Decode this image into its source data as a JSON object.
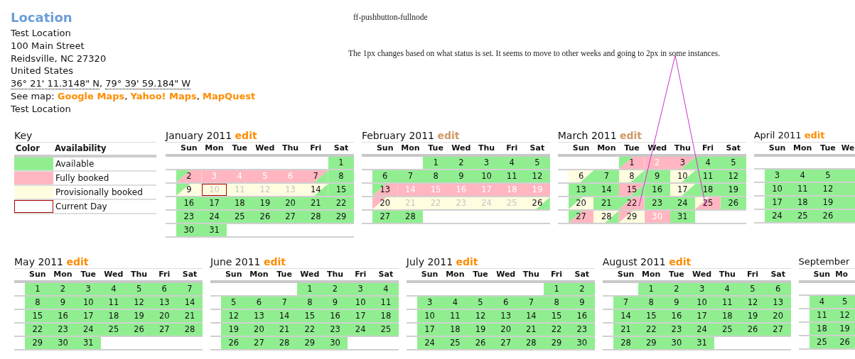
{
  "location": {
    "title": "Location",
    "lines": [
      "Test Location",
      "100 Main Street",
      "Reidsville, NC 27320",
      "United States"
    ],
    "coordinates": [
      {
        "text": "36° 21' 11.3148\" N",
        "after": ","
      },
      {
        "text": "79° 39' 59.184\" W"
      }
    ],
    "map": {
      "label": "See map:",
      "links": [
        {
          "text": "Google Maps",
          "after": ","
        },
        {
          "text": "Yahoo! Maps",
          "after": ","
        },
        {
          "text": "MapQuest"
        }
      ]
    },
    "footer": "Test Location"
  },
  "notes": [
    "ff-pushbutton-fullnode",
    "The 1px changes based on what status is set. It seems to move to other weeks and going to 2px in some instances."
  ],
  "key": {
    "title": "Key",
    "columns": [
      "Color",
      "Availability"
    ],
    "rows": [
      {
        "color": "#90ee90",
        "current": false,
        "label": "Available"
      },
      {
        "color": "#ffb6c1",
        "current": false,
        "label": "Fully booked"
      },
      {
        "color": "#fffde0",
        "current": false,
        "label": "Provisionally booked"
      },
      {
        "current": true,
        "label": "Current Day"
      }
    ]
  },
  "months": [
    {
      "title": "January 2011",
      "edit": "edit",
      "visited": false,
      "weekdays": [
        "Sun",
        "Mon",
        "Tue",
        "Wed",
        "Thu",
        "Fri",
        "Sat"
      ],
      "weeks": [
        [
          {
            "kind": "blank"
          },
          {
            "kind": "blank"
          },
          {
            "kind": "blank"
          },
          {
            "kind": "blank"
          },
          {
            "kind": "blank"
          },
          {
            "kind": "blank"
          },
          {
            "kind": "day",
            "day": "1",
            "color": "#90ee90"
          }
        ],
        [
          {
            "kind": "split",
            "day": "2",
            "halves": [
              {
                "color": "#90ee90"
              },
              {
                "color": "#ffb6c1"
              }
            ]
          },
          {
            "kind": "day",
            "day": "3",
            "color": "#ffb6c1"
          },
          {
            "kind": "day",
            "day": "4",
            "color": "#ffb6c1"
          },
          {
            "kind": "day",
            "day": "5",
            "color": "#ffb6c1"
          },
          {
            "kind": "day",
            "day": "6",
            "color": "#ffb6c1"
          },
          {
            "kind": "split",
            "day": "7",
            "halves": [
              {
                "color": "#ffb6c1"
              },
              {
                "color": "#90ee90"
              }
            ]
          },
          {
            "kind": "day",
            "day": "8",
            "color": "#90ee90"
          }
        ],
        [
          {
            "kind": "split",
            "day": "9",
            "halves": [
              {
                "color": "#90ee90"
              },
              {
                "color": "#fffde0"
              }
            ]
          },
          {
            "kind": "day",
            "day": "10",
            "color": "#fffde0",
            "current": true
          },
          {
            "kind": "day",
            "day": "11",
            "color": "#fffde0"
          },
          {
            "kind": "day",
            "day": "12",
            "color": "#fffde0"
          },
          {
            "kind": "day",
            "day": "13",
            "color": "#fffde0"
          },
          {
            "kind": "split",
            "day": "14",
            "halves": [
              {
                "color": "#fffde0"
              },
              {
                "color": "#90ee90"
              }
            ]
          },
          {
            "kind": "day",
            "day": "15",
            "color": "#90ee90"
          }
        ],
        [
          {
            "kind": "day",
            "day": "16",
            "color": "#90ee90"
          },
          {
            "kind": "day",
            "day": "17",
            "color": "#90ee90"
          },
          {
            "kind": "day",
            "day": "18",
            "color": "#90ee90"
          },
          {
            "kind": "day",
            "day": "19",
            "color": "#90ee90"
          },
          {
            "kind": "day",
            "day": "20",
            "color": "#90ee90"
          },
          {
            "kind": "day",
            "day": "21",
            "color": "#90ee90"
          },
          {
            "kind": "day",
            "day": "22",
            "color": "#90ee90"
          }
        ],
        [
          {
            "kind": "day",
            "day": "23",
            "color": "#90ee90"
          },
          {
            "kind": "day",
            "day": "24",
            "color": "#90ee90"
          },
          {
            "kind": "day",
            "day": "25",
            "color": "#90ee90"
          },
          {
            "kind": "day",
            "day": "26",
            "color": "#90ee90"
          },
          {
            "kind": "day",
            "day": "27",
            "color": "#90ee90"
          },
          {
            "kind": "day",
            "day": "28",
            "color": "#90ee90"
          },
          {
            "kind": "day",
            "day": "29",
            "color": "#90ee90"
          }
        ],
        [
          {
            "kind": "day",
            "day": "30",
            "color": "#90ee90"
          },
          {
            "kind": "day",
            "day": "31",
            "color": "#90ee90"
          },
          {
            "kind": "blank"
          },
          {
            "kind": "blank"
          },
          {
            "kind": "blank"
          },
          {
            "kind": "blank"
          },
          {
            "kind": "blank"
          }
        ]
      ]
    },
    {
      "title": "February 2011",
      "edit": "edit",
      "visited": true,
      "weekdays": [
        "Sun",
        "Mon",
        "Tue",
        "Wed",
        "Thu",
        "Fri",
        "Sat"
      ],
      "weeks": [
        [
          {
            "kind": "blank"
          },
          {
            "kind": "blank"
          },
          {
            "kind": "day",
            "day": "1",
            "color": "#90ee90"
          },
          {
            "kind": "day",
            "day": "2",
            "color": "#90ee90"
          },
          {
            "kind": "day",
            "day": "3",
            "color": "#90ee90"
          },
          {
            "kind": "day",
            "day": "4",
            "color": "#90ee90"
          },
          {
            "kind": "day",
            "day": "5",
            "color": "#90ee90"
          }
        ],
        [
          {
            "kind": "day",
            "day": "6",
            "color": "#90ee90"
          },
          {
            "kind": "day",
            "day": "7",
            "color": "#90ee90"
          },
          {
            "kind": "day",
            "day": "8",
            "color": "#90ee90"
          },
          {
            "kind": "day",
            "day": "9",
            "color": "#90ee90"
          },
          {
            "kind": "day",
            "day": "10",
            "color": "#90ee90"
          },
          {
            "kind": "day",
            "day": "11",
            "color": "#90ee90"
          },
          {
            "kind": "day",
            "day": "12",
            "color": "#90ee90"
          }
        ],
        [
          {
            "kind": "split",
            "day": "13",
            "halves": [
              {
                "color": "#90ee90"
              },
              {
                "color": "#ffb6c1"
              }
            ]
          },
          {
            "kind": "day",
            "day": "14",
            "color": "#ffb6c1"
          },
          {
            "kind": "day",
            "day": "15",
            "color": "#ffb6c1"
          },
          {
            "kind": "day",
            "day": "16",
            "color": "#ffb6c1"
          },
          {
            "kind": "day",
            "day": "17",
            "color": "#ffb6c1"
          },
          {
            "kind": "day",
            "day": "18",
            "color": "#ffb6c1"
          },
          {
            "kind": "day",
            "day": "19",
            "color": "#ffb6c1"
          }
        ],
        [
          {
            "kind": "split",
            "day": "20",
            "halves": [
              {
                "color": "#ffb6c1"
              },
              {
                "color": "#fffde0"
              }
            ]
          },
          {
            "kind": "day",
            "day": "21",
            "color": "#fffde0"
          },
          {
            "kind": "day",
            "day": "22",
            "color": "#fffde0"
          },
          {
            "kind": "day",
            "day": "23",
            "color": "#fffde0"
          },
          {
            "kind": "day",
            "day": "24",
            "color": "#fffde0"
          },
          {
            "kind": "day",
            "day": "25",
            "color": "#fffde0"
          },
          {
            "kind": "split",
            "day": "26",
            "halves": [
              {
                "color": "#fffde0"
              },
              {
                "color": "#90ee90"
              }
            ]
          }
        ],
        [
          {
            "kind": "day",
            "day": "27",
            "color": "#90ee90"
          },
          {
            "kind": "day",
            "day": "28",
            "color": "#90ee90"
          },
          {
            "kind": "blank"
          },
          {
            "kind": "blank"
          },
          {
            "kind": "blank"
          },
          {
            "kind": "blank"
          },
          {
            "kind": "blank"
          }
        ]
      ]
    },
    {
      "title": "March 2011",
      "edit": "edit",
      "visited": true,
      "weekdays": [
        "Sun",
        "Mon",
        "Tue",
        "Wed",
        "Thu",
        "Fri",
        "Sat"
      ],
      "weeks": [
        [
          {
            "kind": "blank"
          },
          {
            "kind": "blank"
          },
          {
            "kind": "split",
            "day": "1",
            "halves": [
              {
                "color": "#90ee90"
              },
              {
                "color": "#ffb6c1"
              }
            ]
          },
          {
            "kind": "day",
            "day": "2",
            "color": "#ffb6c1"
          },
          {
            "kind": "split",
            "day": "3",
            "halves": [
              {
                "color": "#ffb6c1"
              },
              {
                "color": "#90ee90"
              }
            ]
          },
          {
            "kind": "day",
            "day": "4",
            "color": "#90ee90"
          },
          {
            "kind": "day",
            "day": "5",
            "color": "#90ee90"
          }
        ],
        [
          {
            "kind": "split",
            "day": "6",
            "halves": [
              {
                "color": "#fffde0"
              },
              {
                "color": "#90ee90"
              }
            ]
          },
          {
            "kind": "day",
            "day": "7",
            "color": "#90ee90"
          },
          {
            "kind": "split",
            "day": "8",
            "halves": [
              {
                "color": "#fffde0"
              },
              {
                "color": "#90ee90"
              }
            ]
          },
          {
            "kind": "day",
            "day": "9",
            "color": "#90ee90"
          },
          {
            "kind": "split",
            "day": "10",
            "halves": [
              {
                "color": "#fffde0"
              },
              {
                "color": "#90ee90"
              }
            ]
          },
          {
            "kind": "day",
            "day": "11",
            "color": "#90ee90"
          },
          {
            "kind": "day",
            "day": "12",
            "color": "#90ee90"
          }
        ],
        [
          {
            "kind": "day",
            "day": "13",
            "color": "#90ee90"
          },
          {
            "kind": "day",
            "day": "14",
            "color": "#90ee90"
          },
          {
            "kind": "split",
            "day": "15",
            "halves": [
              {
                "color": "#ffb6c1"
              },
              {
                "color": "#90ee90"
              }
            ]
          },
          {
            "kind": "day",
            "day": "16",
            "color": "#90ee90"
          },
          {
            "kind": "split",
            "day": "17",
            "halves": [
              {
                "color": "#fffde0"
              },
              {
                "color": "#90ee90"
              }
            ]
          },
          {
            "kind": "day",
            "day": "18",
            "color": "#90ee90"
          },
          {
            "kind": "day",
            "day": "19",
            "color": "#90ee90"
          }
        ],
        [
          {
            "kind": "split",
            "day": "20",
            "halves": [
              {
                "color": "#90ee90"
              },
              {
                "color": "#fffde0"
              }
            ]
          },
          {
            "kind": "day",
            "day": "21",
            "color": "#90ee90"
          },
          {
            "kind": "split",
            "day": "22",
            "halves": [
              {
                "color": "#90ee90"
              },
              {
                "color": "#ffb6c1"
              }
            ]
          },
          {
            "kind": "day",
            "day": "23",
            "color": "#90ee90"
          },
          {
            "kind": "day",
            "day": "24",
            "color": "#90ee90"
          },
          {
            "kind": "split",
            "day": "25",
            "halves": [
              {
                "color": "#fffde0"
              },
              {
                "color": "#ffb6c1"
              }
            ]
          },
          {
            "kind": "day",
            "day": "26",
            "color": "#90ee90"
          }
        ],
        [
          {
            "kind": "split",
            "day": "27",
            "halves": [
              {
                "color": "#90ee90"
              },
              {
                "color": "#ffb6c1"
              }
            ]
          },
          {
            "kind": "split",
            "day": "28",
            "halves": [
              {
                "color": "#fffde0"
              },
              {
                "color": "#90ee90"
              }
            ]
          },
          {
            "kind": "split",
            "day": "29",
            "halves": [
              {
                "color": "#ffb6c1"
              },
              {
                "color": "#fffde0"
              }
            ]
          },
          {
            "kind": "day",
            "day": "30",
            "color": "#ffb6c1"
          },
          {
            "kind": "day",
            "day": "31",
            "color": "#90ee90"
          },
          {
            "kind": "blank"
          },
          {
            "kind": "blank"
          }
        ]
      ]
    },
    {
      "title": "April 2011",
      "edit": "edit",
      "visited": false,
      "weekdays": [
        "Sun",
        "Mon",
        "Tue",
        "We"
      ],
      "weeks": [
        [
          {
            "kind": "blank"
          },
          {
            "kind": "blank"
          },
          {
            "kind": "blank"
          },
          {
            "kind": "blank"
          }
        ],
        [
          {
            "kind": "day",
            "day": "3",
            "color": "#90ee90"
          },
          {
            "kind": "day",
            "day": "4",
            "color": "#90ee90"
          },
          {
            "kind": "day",
            "day": "5",
            "color": "#90ee90"
          },
          {
            "kind": "day",
            "color": "#90ee90"
          }
        ],
        [
          {
            "kind": "day",
            "day": "10",
            "color": "#90ee90"
          },
          {
            "kind": "day",
            "day": "11",
            "color": "#90ee90"
          },
          {
            "kind": "day",
            "day": "12",
            "color": "#90ee90"
          },
          {
            "kind": "day",
            "color": "#90ee90"
          }
        ],
        [
          {
            "kind": "day",
            "day": "17",
            "color": "#90ee90"
          },
          {
            "kind": "day",
            "day": "18",
            "color": "#90ee90"
          },
          {
            "kind": "day",
            "day": "19",
            "color": "#90ee90"
          },
          {
            "kind": "day",
            "color": "#90ee90"
          }
        ],
        [
          {
            "kind": "day",
            "day": "24",
            "color": "#90ee90"
          },
          {
            "kind": "day",
            "day": "25",
            "color": "#90ee90"
          },
          {
            "kind": "day",
            "day": "26",
            "color": "#90ee90"
          },
          {
            "kind": "day",
            "color": "#90ee90"
          }
        ]
      ]
    },
    {
      "title": "May 2011",
      "edit": "edit",
      "visited": false,
      "weekdays": [
        "Sun",
        "Mon",
        "Tue",
        "Wed",
        "Thu",
        "Fri",
        "Sat"
      ],
      "weeks": [
        [
          {
            "kind": "day",
            "day": "1",
            "color": "#90ee90"
          },
          {
            "kind": "day",
            "day": "2",
            "color": "#90ee90"
          },
          {
            "kind": "day",
            "day": "3",
            "color": "#90ee90"
          },
          {
            "kind": "day",
            "day": "4",
            "color": "#90ee90"
          },
          {
            "kind": "day",
            "day": "5",
            "color": "#90ee90"
          },
          {
            "kind": "day",
            "day": "6",
            "color": "#90ee90"
          },
          {
            "kind": "day",
            "day": "7",
            "color": "#90ee90"
          }
        ],
        [
          {
            "kind": "day",
            "day": "8",
            "color": "#90ee90"
          },
          {
            "kind": "day",
            "day": "9",
            "color": "#90ee90"
          },
          {
            "kind": "day",
            "day": "10",
            "color": "#90ee90"
          },
          {
            "kind": "day",
            "day": "11",
            "color": "#90ee90"
          },
          {
            "kind": "day",
            "day": "12",
            "color": "#90ee90"
          },
          {
            "kind": "day",
            "day": "13",
            "color": "#90ee90"
          },
          {
            "kind": "day",
            "day": "14",
            "color": "#90ee90"
          }
        ],
        [
          {
            "kind": "day",
            "day": "15",
            "color": "#90ee90"
          },
          {
            "kind": "day",
            "day": "16",
            "color": "#90ee90"
          },
          {
            "kind": "day",
            "day": "17",
            "color": "#90ee90"
          },
          {
            "kind": "day",
            "day": "18",
            "color": "#90ee90"
          },
          {
            "kind": "day",
            "day": "19",
            "color": "#90ee90"
          },
          {
            "kind": "day",
            "day": "20",
            "color": "#90ee90"
          },
          {
            "kind": "day",
            "day": "21",
            "color": "#90ee90"
          }
        ],
        [
          {
            "kind": "day",
            "day": "22",
            "color": "#90ee90"
          },
          {
            "kind": "day",
            "day": "23",
            "color": "#90ee90"
          },
          {
            "kind": "day",
            "day": "24",
            "color": "#90ee90"
          },
          {
            "kind": "day",
            "day": "25",
            "color": "#90ee90"
          },
          {
            "kind": "day",
            "day": "26",
            "color": "#90ee90"
          },
          {
            "kind": "day",
            "day": "27",
            "color": "#90ee90"
          },
          {
            "kind": "day",
            "day": "28",
            "color": "#90ee90"
          }
        ],
        [
          {
            "kind": "day",
            "day": "29",
            "color": "#90ee90"
          },
          {
            "kind": "day",
            "day": "30",
            "color": "#90ee90"
          },
          {
            "kind": "day",
            "day": "31",
            "color": "#90ee90"
          },
          {
            "kind": "blank"
          },
          {
            "kind": "blank"
          },
          {
            "kind": "blank"
          },
          {
            "kind": "blank"
          }
        ]
      ]
    },
    {
      "title": "June 2011",
      "edit": "edit",
      "visited": false,
      "weekdays": [
        "Sun",
        "Mon",
        "Tue",
        "Wed",
        "Thu",
        "Fri",
        "Sat"
      ],
      "weeks": [
        [
          {
            "kind": "blank"
          },
          {
            "kind": "blank"
          },
          {
            "kind": "blank"
          },
          {
            "kind": "day",
            "day": "1",
            "color": "#90ee90"
          },
          {
            "kind": "day",
            "day": "2",
            "color": "#90ee90"
          },
          {
            "kind": "day",
            "day": "3",
            "color": "#90ee90"
          },
          {
            "kind": "day",
            "day": "4",
            "color": "#90ee90"
          }
        ],
        [
          {
            "kind": "day",
            "day": "5",
            "color": "#90ee90"
          },
          {
            "kind": "day",
            "day": "6",
            "color": "#90ee90"
          },
          {
            "kind": "day",
            "day": "7",
            "color": "#90ee90"
          },
          {
            "kind": "day",
            "day": "8",
            "color": "#90ee90"
          },
          {
            "kind": "day",
            "day": "9",
            "color": "#90ee90"
          },
          {
            "kind": "day",
            "day": "10",
            "color": "#90ee90"
          },
          {
            "kind": "day",
            "day": "11",
            "color": "#90ee90"
          }
        ],
        [
          {
            "kind": "day",
            "day": "12",
            "color": "#90ee90"
          },
          {
            "kind": "day",
            "day": "13",
            "color": "#90ee90"
          },
          {
            "kind": "day",
            "day": "14",
            "color": "#90ee90"
          },
          {
            "kind": "day",
            "day": "15",
            "color": "#90ee90"
          },
          {
            "kind": "day",
            "day": "16",
            "color": "#90ee90"
          },
          {
            "kind": "day",
            "day": "17",
            "color": "#90ee90"
          },
          {
            "kind": "day",
            "day": "18",
            "color": "#90ee90"
          }
        ],
        [
          {
            "kind": "day",
            "day": "19",
            "color": "#90ee90"
          },
          {
            "kind": "day",
            "day": "20",
            "color": "#90ee90"
          },
          {
            "kind": "day",
            "day": "21",
            "color": "#90ee90"
          },
          {
            "kind": "day",
            "day": "22",
            "color": "#90ee90"
          },
          {
            "kind": "day",
            "day": "23",
            "color": "#90ee90"
          },
          {
            "kind": "day",
            "day": "24",
            "color": "#90ee90"
          },
          {
            "kind": "day",
            "day": "25",
            "color": "#90ee90"
          }
        ],
        [
          {
            "kind": "day",
            "day": "26",
            "color": "#90ee90"
          },
          {
            "kind": "day",
            "day": "27",
            "color": "#90ee90"
          },
          {
            "kind": "day",
            "day": "28",
            "color": "#90ee90"
          },
          {
            "kind": "day",
            "day": "29",
            "color": "#90ee90"
          },
          {
            "kind": "day",
            "day": "30",
            "color": "#90ee90"
          },
          {
            "kind": "blank"
          },
          {
            "kind": "blank"
          }
        ]
      ]
    },
    {
      "title": "July 2011",
      "edit": "edit",
      "visited": false,
      "weekdays": [
        "Sun",
        "Mon",
        "Tue",
        "Wed",
        "Thu",
        "Fri",
        "Sat"
      ],
      "weeks": [
        [
          {
            "kind": "blank"
          },
          {
            "kind": "blank"
          },
          {
            "kind": "blank"
          },
          {
            "kind": "blank"
          },
          {
            "kind": "blank"
          },
          {
            "kind": "day",
            "day": "1",
            "color": "#90ee90"
          },
          {
            "kind": "day",
            "day": "2",
            "color": "#90ee90"
          }
        ],
        [
          {
            "kind": "day",
            "day": "3",
            "color": "#90ee90"
          },
          {
            "kind": "day",
            "day": "4",
            "color": "#90ee90"
          },
          {
            "kind": "day",
            "day": "5",
            "color": "#90ee90"
          },
          {
            "kind": "day",
            "day": "6",
            "color": "#90ee90"
          },
          {
            "kind": "day",
            "day": "7",
            "color": "#90ee90"
          },
          {
            "kind": "day",
            "day": "8",
            "color": "#90ee90"
          },
          {
            "kind": "day",
            "day": "9",
            "color": "#90ee90"
          }
        ],
        [
          {
            "kind": "day",
            "day": "10",
            "color": "#90ee90"
          },
          {
            "kind": "day",
            "day": "11",
            "color": "#90ee90"
          },
          {
            "kind": "day",
            "day": "12",
            "color": "#90ee90"
          },
          {
            "kind": "day",
            "day": "13",
            "color": "#90ee90"
          },
          {
            "kind": "day",
            "day": "14",
            "color": "#90ee90"
          },
          {
            "kind": "day",
            "day": "15",
            "color": "#90ee90"
          },
          {
            "kind": "day",
            "day": "16",
            "color": "#90ee90"
          }
        ],
        [
          {
            "kind": "day",
            "day": "17",
            "color": "#90ee90"
          },
          {
            "kind": "day",
            "day": "18",
            "color": "#90ee90"
          },
          {
            "kind": "day",
            "day": "19",
            "color": "#90ee90"
          },
          {
            "kind": "day",
            "day": "20",
            "color": "#90ee90"
          },
          {
            "kind": "day",
            "day": "21",
            "color": "#90ee90"
          },
          {
            "kind": "day",
            "day": "22",
            "color": "#90ee90"
          },
          {
            "kind": "day",
            "day": "23",
            "color": "#90ee90"
          }
        ],
        [
          {
            "kind": "day",
            "day": "24",
            "color": "#90ee90"
          },
          {
            "kind": "day",
            "day": "25",
            "color": "#90ee90"
          },
          {
            "kind": "day",
            "day": "26",
            "color": "#90ee90"
          },
          {
            "kind": "day",
            "day": "27",
            "color": "#90ee90"
          },
          {
            "kind": "day",
            "day": "28",
            "color": "#90ee90"
          },
          {
            "kind": "day",
            "day": "29",
            "color": "#90ee90"
          },
          {
            "kind": "day",
            "day": "30",
            "color": "#90ee90"
          }
        ]
      ]
    },
    {
      "title": "August 2011",
      "edit": "edit",
      "visited": false,
      "weekdays": [
        "Sun",
        "Mon",
        "Tue",
        "Wed",
        "Thu",
        "Fri",
        "Sat"
      ],
      "weeks": [
        [
          {
            "kind": "blank"
          },
          {
            "kind": "day",
            "day": "1",
            "color": "#90ee90"
          },
          {
            "kind": "day",
            "day": "2",
            "color": "#90ee90"
          },
          {
            "kind": "day",
            "day": "3",
            "color": "#90ee90"
          },
          {
            "kind": "day",
            "day": "4",
            "color": "#90ee90"
          },
          {
            "kind": "day",
            "day": "5",
            "color": "#90ee90"
          },
          {
            "kind": "day",
            "day": "6",
            "color": "#90ee90"
          }
        ],
        [
          {
            "kind": "day",
            "day": "7",
            "color": "#90ee90"
          },
          {
            "kind": "day",
            "day": "8",
            "color": "#90ee90"
          },
          {
            "kind": "day",
            "day": "9",
            "color": "#90ee90"
          },
          {
            "kind": "day",
            "day": "10",
            "color": "#90ee90"
          },
          {
            "kind": "day",
            "day": "11",
            "color": "#90ee90"
          },
          {
            "kind": "day",
            "day": "12",
            "color": "#90ee90"
          },
          {
            "kind": "day",
            "day": "13",
            "color": "#90ee90"
          }
        ],
        [
          {
            "kind": "day",
            "day": "14",
            "color": "#90ee90"
          },
          {
            "kind": "day",
            "day": "15",
            "color": "#90ee90"
          },
          {
            "kind": "day",
            "day": "16",
            "color": "#90ee90"
          },
          {
            "kind": "day",
            "day": "17",
            "color": "#90ee90"
          },
          {
            "kind": "day",
            "day": "18",
            "color": "#90ee90"
          },
          {
            "kind": "day",
            "day": "19",
            "color": "#90ee90"
          },
          {
            "kind": "day",
            "day": "20",
            "color": "#90ee90"
          }
        ],
        [
          {
            "kind": "day",
            "day": "21",
            "color": "#90ee90"
          },
          {
            "kind": "day",
            "day": "22",
            "color": "#90ee90"
          },
          {
            "kind": "day",
            "day": "23",
            "color": "#90ee90"
          },
          {
            "kind": "day",
            "day": "24",
            "color": "#90ee90"
          },
          {
            "kind": "day",
            "day": "25",
            "color": "#90ee90"
          },
          {
            "kind": "day",
            "day": "26",
            "color": "#90ee90"
          },
          {
            "kind": "day",
            "day": "27",
            "color": "#90ee90"
          }
        ],
        [
          {
            "kind": "day",
            "day": "28",
            "color": "#90ee90"
          },
          {
            "kind": "day",
            "day": "29",
            "color": "#90ee90"
          },
          {
            "kind": "day",
            "day": "30",
            "color": "#90ee90"
          },
          {
            "kind": "day",
            "day": "31",
            "color": "#90ee90"
          },
          {
            "kind": "blank"
          },
          {
            "kind": "blank"
          },
          {
            "kind": "blank"
          }
        ]
      ]
    },
    {
      "title": "September",
      "weekdays": [
        "Sun",
        "Mo"
      ],
      "weeks": [
        [
          {
            "kind": "blank"
          },
          {
            "kind": "blank"
          }
        ],
        [
          {
            "kind": "day",
            "day": "4",
            "color": "#90ee90"
          },
          {
            "kind": "day",
            "day": "5",
            "color": "#90ee90"
          }
        ],
        [
          {
            "kind": "day",
            "day": "11",
            "color": "#90ee90"
          },
          {
            "kind": "day",
            "day": "12",
            "color": "#90ee90"
          }
        ],
        [
          {
            "kind": "day",
            "day": "18",
            "color": "#90ee90"
          },
          {
            "kind": "day",
            "day": "19",
            "color": "#90ee90"
          }
        ],
        [
          {
            "kind": "day",
            "day": "25",
            "color": "#90ee90"
          },
          {
            "kind": "day",
            "day": "26",
            "color": "#90ee90"
          }
        ]
      ]
    }
  ]
}
